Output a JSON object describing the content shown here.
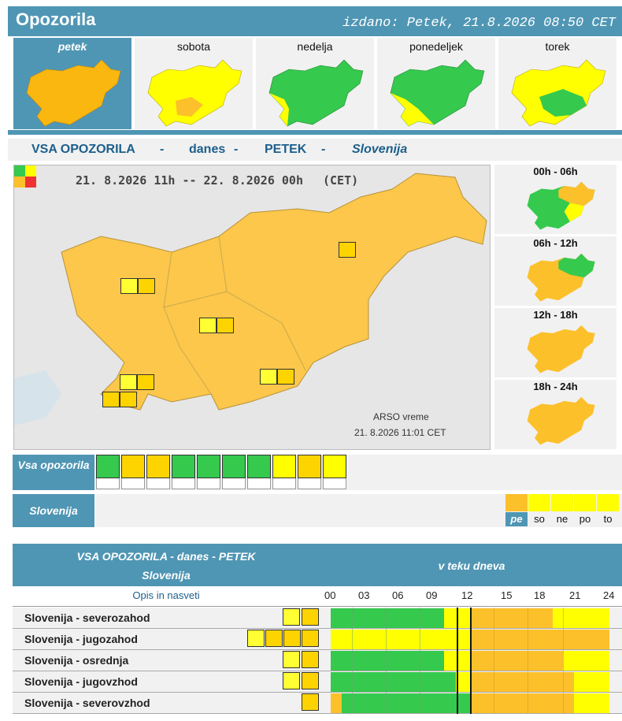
{
  "header": {
    "title": "Opozorila",
    "issued": "izdano: Petek, 21.8.2026 08:50 CET"
  },
  "days": [
    {
      "label": "petek",
      "selected": true
    },
    {
      "label": "sobota",
      "selected": false
    },
    {
      "label": "nedelja",
      "selected": false
    },
    {
      "label": "ponedeljek",
      "selected": false
    },
    {
      "label": "torek",
      "selected": false
    }
  ],
  "section": {
    "title": "VSA OPOZORILA",
    "sep": "-",
    "when": "danes",
    "day": "PETEK",
    "region": "Slovenija"
  },
  "map": {
    "range": "21. 8.2026 11h  --  22. 8.2026 00h",
    "tz": "(CET)",
    "source": "ARSO vreme",
    "stamp": "21. 8.2026  11:01 CET"
  },
  "periods": [
    "00h - 06h",
    "06h - 12h",
    "12h - 18h",
    "18h - 24h"
  ],
  "legend": {
    "vsa_label": "Vsa opozorila",
    "region_label": "Slovenija",
    "icons": [
      "wind-icon",
      "rain-icon",
      "thunderstorm-icon",
      "snow-icon",
      "snow-ice-icon",
      "high-temperature-icon",
      "low-temperature-icon",
      "forest-fire-icon",
      "coastal-icon",
      "flood-icon"
    ],
    "days": [
      "pe",
      "so",
      "ne",
      "po",
      "to"
    ]
  },
  "table": {
    "title": "VSA OPOZORILA - danes - PETEK",
    "region": "Slovenija",
    "timeline_title": "v teku dneva",
    "opis": "Opis in nasveti",
    "hours": [
      "00",
      "03",
      "06",
      "09",
      "12",
      "15",
      "18",
      "21",
      "24"
    ],
    "rows": [
      {
        "name": "Slovenija - severozahod",
        "icons": [
          "rain-icon",
          "thunderstorm-icon"
        ]
      },
      {
        "name": "Slovenija - jugozahod",
        "icons": [
          "rain-icon",
          "thunderstorm-icon",
          "forest-fire-icon",
          "coastal-icon"
        ]
      },
      {
        "name": "Slovenija - osrednja",
        "icons": [
          "rain-icon",
          "thunderstorm-icon"
        ]
      },
      {
        "name": "Slovenija - jugovzhod",
        "icons": [
          "rain-icon",
          "thunderstorm-icon"
        ]
      },
      {
        "name": "Slovenija - severovzhod",
        "icons": [
          "thunderstorm-icon"
        ]
      }
    ]
  },
  "colors": {
    "green": "#35c94e",
    "yellow": "#ffff00",
    "orange": "#fcc02b",
    "red": "#ee3333",
    "accent": "#4f96b4"
  }
}
